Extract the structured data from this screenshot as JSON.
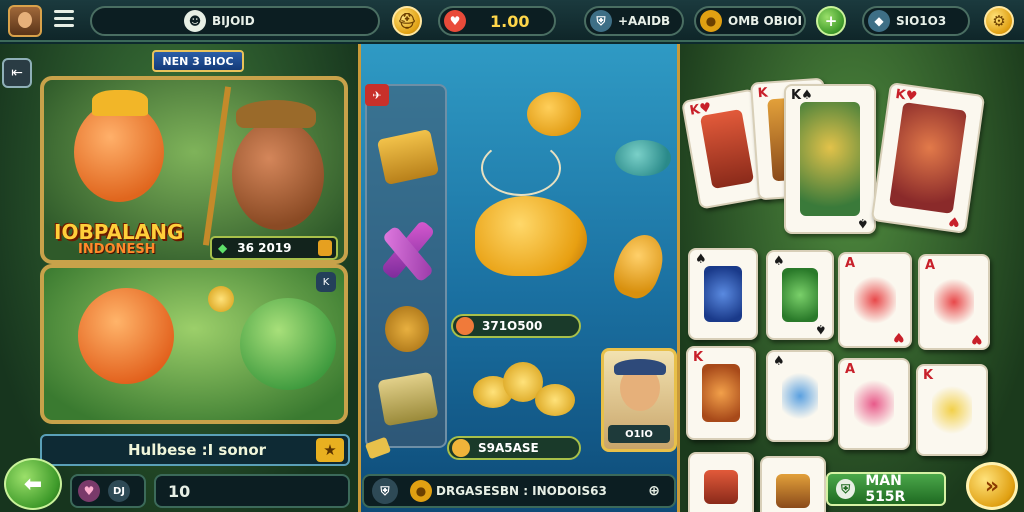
{
  "topbar": {
    "player_name": "BIJOID",
    "balance": "1.00",
    "stat_one": "+AAIDB",
    "stat_two": "OMB OBIOI",
    "stat_three": "SIO1O3",
    "icons": {
      "menu": "hamburger-icon",
      "player": "player-icon",
      "helmet": "helmet-icon",
      "heart": "heart-icon",
      "shield": "shield-icon",
      "coins": "coins-icon",
      "plus": "plus-icon",
      "gem": "gem-icon",
      "settings": "settings-icon"
    }
  },
  "left": {
    "tag": "NEN 3 BIOC",
    "game_title": "IOBPALANG",
    "game_subtitle": "INDONESH",
    "score": "36 2019",
    "close_label": "K",
    "bar_text": "Hulbese :I sonor",
    "footer_value": "10",
    "footer_icon_text": "DJ"
  },
  "middle": {
    "top_badge": "✈",
    "chip_one": "371O500",
    "chip_two": "S9A5ASE",
    "card_value": "O1IO",
    "footer_text": "DRGASESBN : INODOIS63"
  },
  "right": {
    "win_text": "MAN 515R",
    "go_symbol": "»"
  },
  "colors": {
    "accent_gold": "#e0a012",
    "panel_border": "#c99a3a",
    "chip_border": "#a8c04a"
  }
}
